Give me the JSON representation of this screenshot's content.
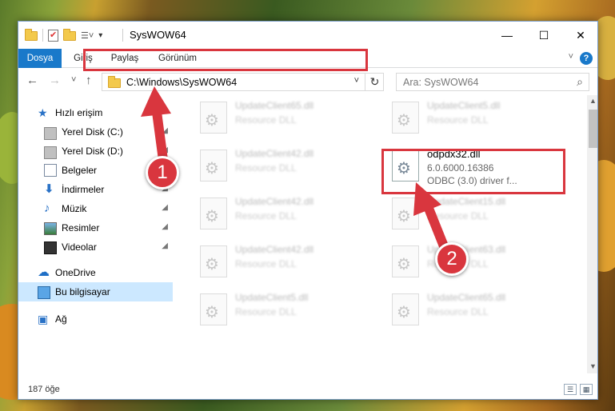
{
  "window": {
    "title": "SysWOW64",
    "controls": {
      "minimize": "—",
      "maximize": "☐",
      "close": "✕"
    }
  },
  "ribbon": {
    "tabs": [
      {
        "label": "Dosya",
        "active": true
      },
      {
        "label": "Giriş",
        "active": false
      },
      {
        "label": "Paylaş",
        "active": false
      },
      {
        "label": "Görünüm",
        "active": false
      }
    ],
    "help": "?",
    "collapse": "˅"
  },
  "nav": {
    "back": "←",
    "forward": "→",
    "recent": "˅",
    "up": "↑",
    "address": "C:\\Windows\\SysWOW64",
    "address_dropdown": "˅",
    "refresh": "↻",
    "search_placeholder": "Ara: SysWOW64",
    "search_icon": "⌕"
  },
  "sidebar": {
    "items": [
      {
        "label": "Hızlı erişim",
        "icon": "star-icon",
        "pinned": false
      },
      {
        "label": "Yerel Disk (C:)",
        "icon": "drive-icon",
        "pinned": true
      },
      {
        "label": "Yerel Disk (D:)",
        "icon": "drive-icon",
        "pinned": true
      },
      {
        "label": "Belgeler",
        "icon": "document-icon",
        "pinned": true
      },
      {
        "label": "İndirmeler",
        "icon": "download-icon",
        "pinned": true
      },
      {
        "label": "Müzik",
        "icon": "music-icon",
        "pinned": true
      },
      {
        "label": "Resimler",
        "icon": "pictures-icon",
        "pinned": true
      },
      {
        "label": "Videolar",
        "icon": "videos-icon",
        "pinned": true
      },
      {
        "label": "OneDrive",
        "icon": "cloud-icon",
        "pinned": false
      },
      {
        "label": "Bu bilgisayar",
        "icon": "computer-icon",
        "pinned": false,
        "selected": true
      },
      {
        "label": "Ağ",
        "icon": "network-icon",
        "pinned": false
      }
    ],
    "pin_glyph": "📌"
  },
  "files": [
    {
      "name": "UpdateClient65.dll",
      "desc": "Resource DLL"
    },
    {
      "name": "UpdateClient5.dll",
      "desc": "Resource DLL"
    },
    {
      "name": "UpdateClient42.dll",
      "desc": "Resource DLL"
    },
    {
      "name": "odpdx32.dll",
      "desc": "6.0.6000.16386",
      "desc2": "ODBC (3.0) driver f...",
      "highlighted": true
    },
    {
      "name": "UpdateClient42.dll",
      "desc": "Resource DLL"
    },
    {
      "name": "UpdateClient15.dll",
      "desc": "Resource DLL"
    },
    {
      "name": "UpdateClient42.dll",
      "desc": "Resource DLL"
    },
    {
      "name": "UpdateClient63.dll",
      "desc": "Resource DLL"
    },
    {
      "name": "UpdateClient5.dll",
      "desc": "Resource DLL"
    },
    {
      "name": "UpdateClient65.dll",
      "desc": "Resource DLL"
    }
  ],
  "status": {
    "count": "187 öğe"
  },
  "annotations": {
    "badge1": "1",
    "badge2": "2",
    "color": "#d9363e"
  }
}
